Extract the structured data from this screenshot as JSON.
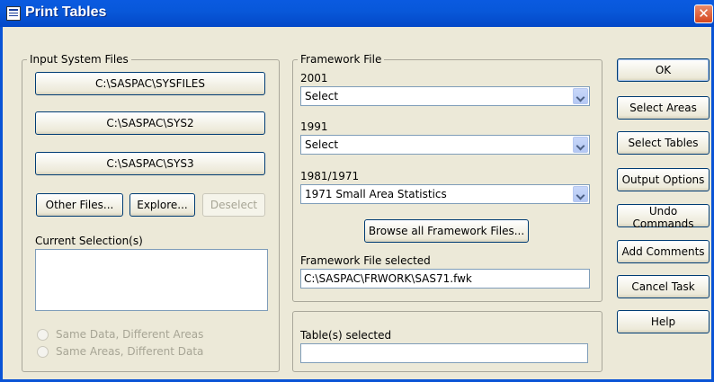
{
  "window": {
    "title": "Print Tables",
    "close_label": "✕"
  },
  "input_system_files": {
    "legend": "Input System Files",
    "buttons": [
      "C:\\SASPAC\\SYSFILES",
      "C:\\SASPAC\\SYS2",
      "C:\\SASPAC\\SYS3"
    ],
    "other_files_label": "Other Files...",
    "explore_label": "Explore...",
    "deselect_label": "Deselect",
    "current_selection_label": "Current Selection(s)",
    "current_selection_value": "",
    "radio_options": [
      "Same Data, Different Areas",
      "Same Areas, Different Data"
    ]
  },
  "framework_file": {
    "legend": "Framework File",
    "combos": [
      {
        "label": "2001",
        "value": "Select"
      },
      {
        "label": "1991",
        "value": "Select"
      },
      {
        "label": "1981/1971",
        "value": "1971 Small Area Statistics"
      }
    ],
    "browse_label": "Browse all Framework Files...",
    "selected_label": "Framework File selected",
    "selected_value": "C:\\SASPAC\\FRWORK\\SAS71.fwk"
  },
  "tables": {
    "label": "Table(s) selected",
    "value": ""
  },
  "actions": {
    "ok": "OK",
    "select_areas": "Select Areas",
    "select_tables": "Select Tables",
    "output_options": "Output Options",
    "undo_commands": "Undo Commands",
    "add_comments": "Add Comments",
    "cancel_task": "Cancel Task",
    "help": "Help"
  }
}
